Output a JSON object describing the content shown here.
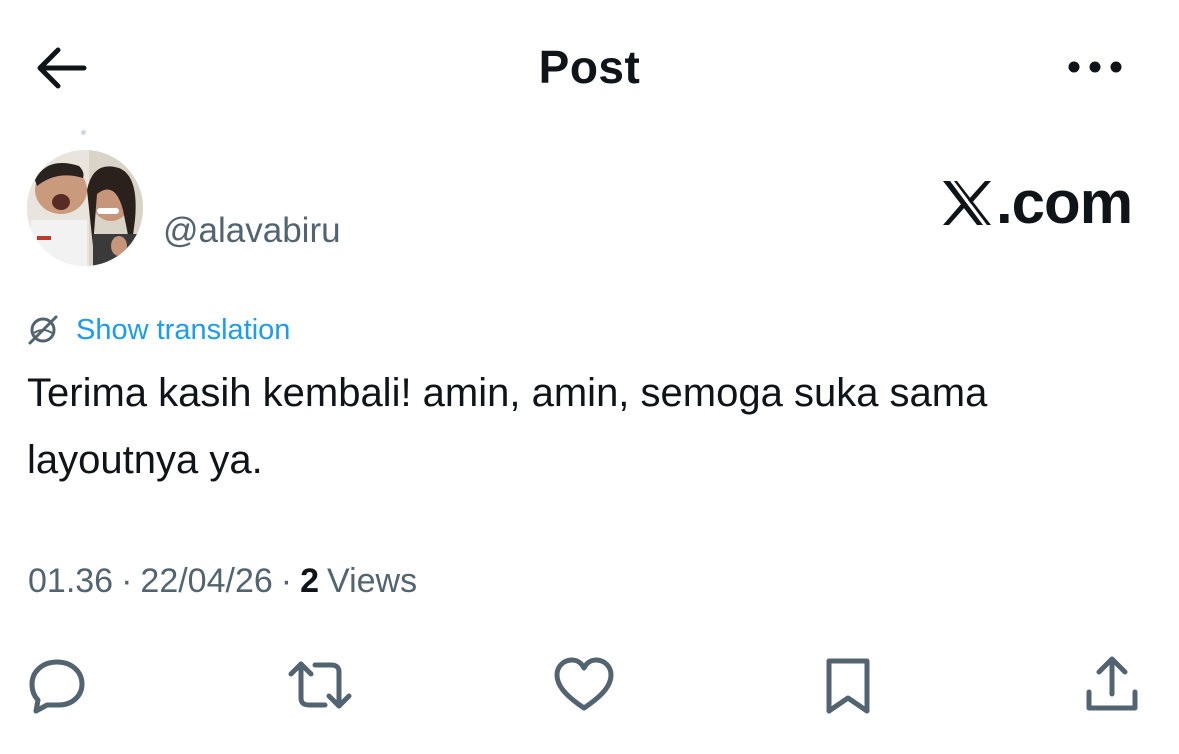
{
  "header": {
    "title": "Post",
    "back_icon": "arrow-left-icon",
    "more_icon": "more-horizontal-icon"
  },
  "author": {
    "handle": "@alavabiru"
  },
  "watermark": {
    "text": ".com",
    "logo_icon": "x-logo-icon"
  },
  "translation": {
    "label": "Show translation",
    "icon": "globe-translate-icon"
  },
  "post": {
    "text": "Terima kasih kembali! amin, amin, semoga suka sama layoutnya ya."
  },
  "meta": {
    "time": "01.36",
    "separator": "·",
    "date": "22/04/26",
    "views_count": "2",
    "views_label": "Views"
  },
  "actions": {
    "reply_icon": "reply-icon",
    "repost_icon": "repost-icon",
    "like_icon": "heart-icon",
    "bookmark_icon": "bookmark-icon",
    "share_icon": "share-icon"
  },
  "colors": {
    "text_primary": "#0f1419",
    "text_secondary": "#536471",
    "link": "#1d9bf0",
    "icon": "#536471"
  }
}
